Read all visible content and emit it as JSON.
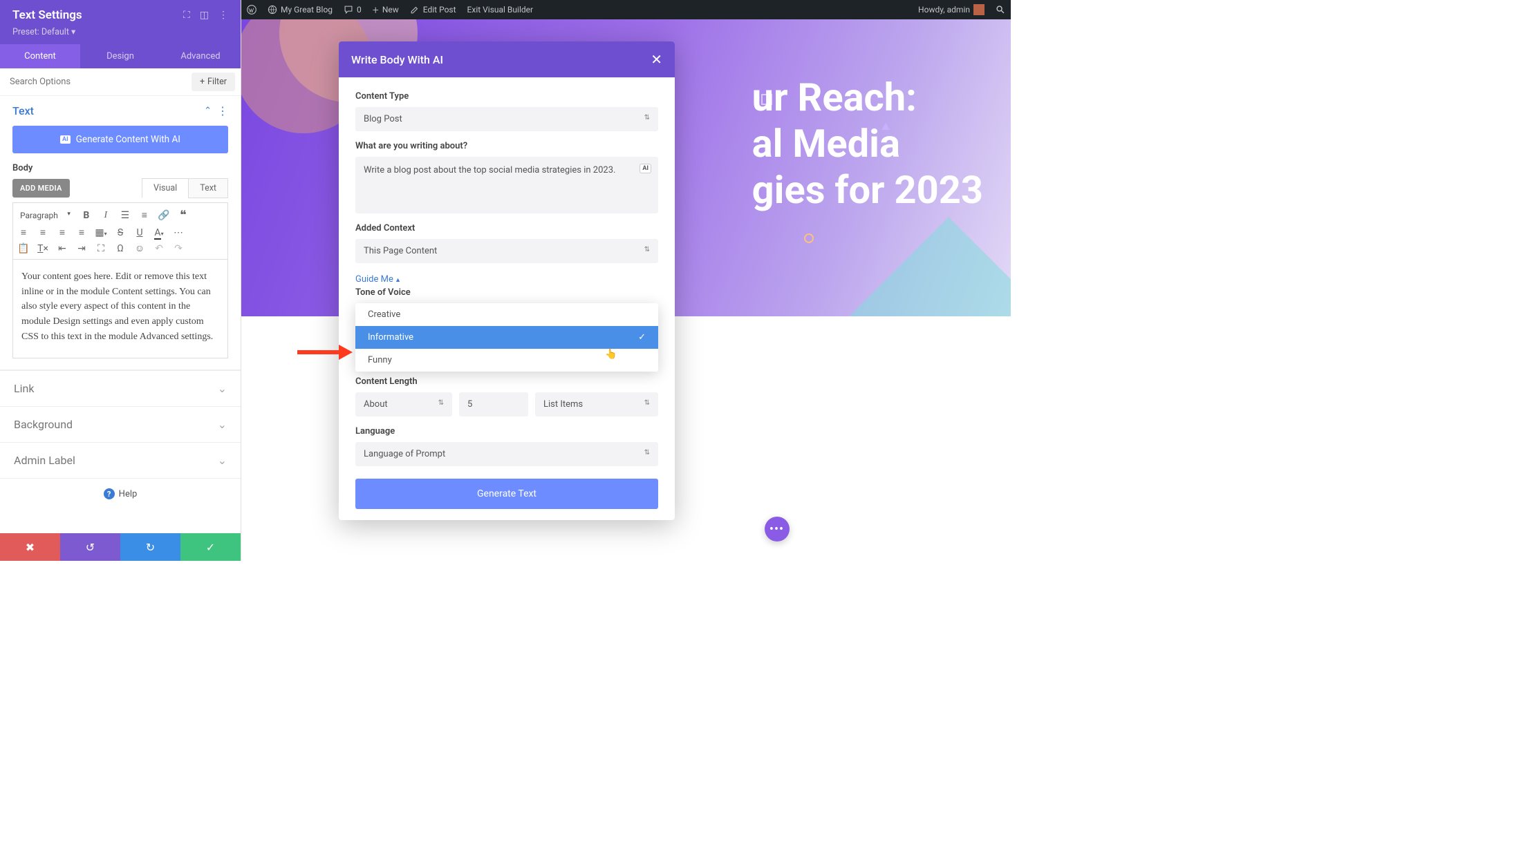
{
  "wpbar": {
    "site": "My Great Blog",
    "comments": "0",
    "new": "New",
    "edit": "Edit Post",
    "exit": "Exit Visual Builder",
    "howdy": "Howdy, admin"
  },
  "sidebar": {
    "title": "Text Settings",
    "preset": "Preset: Default",
    "tabs": {
      "content": "Content",
      "design": "Design",
      "advanced": "Advanced"
    },
    "search_placeholder": "Search Options",
    "filter": "Filter",
    "section_text": "Text",
    "gen_ai": "Generate Content With AI",
    "body_label": "Body",
    "add_media": "ADD MEDIA",
    "editor_tabs": {
      "visual": "Visual",
      "text": "Text"
    },
    "paragraph": "Paragraph",
    "editor_content": "Your content goes here. Edit or remove this text inline or in the module Content settings. You can also style every aspect of this content in the module Design settings and even apply custom CSS to this text in the module Advanced settings.",
    "sections": {
      "link": "Link",
      "background": "Background",
      "admin": "Admin Label"
    },
    "help": "Help"
  },
  "hero": {
    "text": "ur Reach:\nal Media\ngies for 2023"
  },
  "modal": {
    "title": "Write Body With AI",
    "content_type_label": "Content Type",
    "content_type": "Blog Post",
    "about_label": "What are you writing about?",
    "about_value": "Write a blog post about the top social media strategies in 2023.",
    "context_label": "Added Context",
    "context": "This Page Content",
    "guide_me": "Guide Me",
    "tone_label": "Tone of Voice",
    "tone_options": [
      "Creative",
      "Informative",
      "Funny"
    ],
    "tone_selected": "Informative",
    "length_label": "Content Length",
    "length_about": "About",
    "length_num": "5",
    "length_unit": "List Items",
    "lang_label": "Language",
    "lang": "Language of Prompt",
    "generate": "Generate Text"
  }
}
